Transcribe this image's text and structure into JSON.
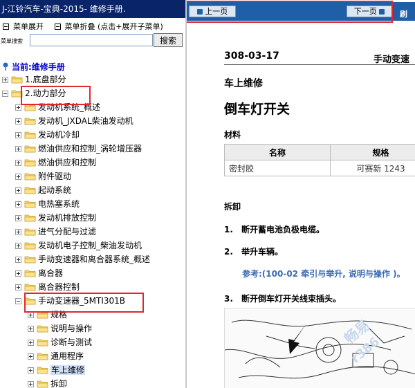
{
  "window_title": "J-江铃汽车-宝典-2015- 维修手册.",
  "menu": {
    "expand_label": "菜单展开",
    "collapse_label": "菜单折叠 (点击+展开子菜单)"
  },
  "search": {
    "label": "菜单搜索",
    "value": "",
    "button_label": "搜索"
  },
  "current": "当前:维修手册",
  "tree": [
    {
      "label": "1.底盘部分",
      "level": 0,
      "expander": "plus"
    },
    {
      "label": "2.动力部分",
      "level": 0,
      "expander": "minus"
    },
    {
      "label": "发动机系统_概述",
      "level": 1,
      "expander": "plus"
    },
    {
      "label": "发动机_JXDAL柴油发动机",
      "level": 1,
      "expander": "plus"
    },
    {
      "label": "发动机冷却",
      "level": 1,
      "expander": "plus"
    },
    {
      "label": "燃油供应和控制_涡轮增压器",
      "level": 1,
      "expander": "plus"
    },
    {
      "label": "燃油供应和控制",
      "level": 1,
      "expander": "plus"
    },
    {
      "label": "附件驱动",
      "level": 1,
      "expander": "plus"
    },
    {
      "label": "起动系统",
      "level": 1,
      "expander": "plus"
    },
    {
      "label": "电热塞系统",
      "level": 1,
      "expander": "plus"
    },
    {
      "label": "发动机排放控制",
      "level": 1,
      "expander": "plus"
    },
    {
      "label": "进气分配与过滤",
      "level": 1,
      "expander": "plus"
    },
    {
      "label": "发动机电子控制_柴油发动机",
      "level": 1,
      "expander": "plus"
    },
    {
      "label": "手动变速器和离合器系统_概述",
      "level": 1,
      "expander": "plus"
    },
    {
      "label": "离合器",
      "level": 1,
      "expander": "plus"
    },
    {
      "label": "离合器控制",
      "level": 1,
      "expander": "plus"
    },
    {
      "label": "手动变速器_5MTI301B",
      "level": 1,
      "expander": "minus"
    },
    {
      "label": "规格",
      "level": 2,
      "expander": "plus"
    },
    {
      "label": "说明与操作",
      "level": 2,
      "expander": "plus"
    },
    {
      "label": "诊断与测试",
      "level": 2,
      "expander": "plus"
    },
    {
      "label": "通用程序",
      "level": 2,
      "expander": "plus"
    },
    {
      "label": "车上维修",
      "level": 2,
      "expander": "plus",
      "selected": true
    },
    {
      "label": "拆卸",
      "level": 2,
      "expander": "plus"
    }
  ],
  "nav": {
    "prev_label": "上一页",
    "next_label": "下一页",
    "right_label": "刷"
  },
  "doc": {
    "number": "308-03-17",
    "header_right": "手动变速",
    "section": "车上维修",
    "title": "倒车灯开关",
    "materials_heading": "材料",
    "materials_columns": [
      "名称",
      "规格"
    ],
    "materials_rows": [
      [
        "密封胶",
        "可赛新 1243"
      ]
    ],
    "removal_heading": "拆卸",
    "steps": [
      {
        "num": "1.",
        "text": "断开蓄电池负极电缆。"
      },
      {
        "num": "2.",
        "text": "举升车辆。"
      },
      {
        "num": "3.",
        "text": "断开倒车灯开关线束插头。"
      }
    ],
    "note": "参考:(100-02 牵引与举升, 说明与操作 )。"
  },
  "watermark": {
    "line1": "畅易",
    "line2": "r386"
  }
}
